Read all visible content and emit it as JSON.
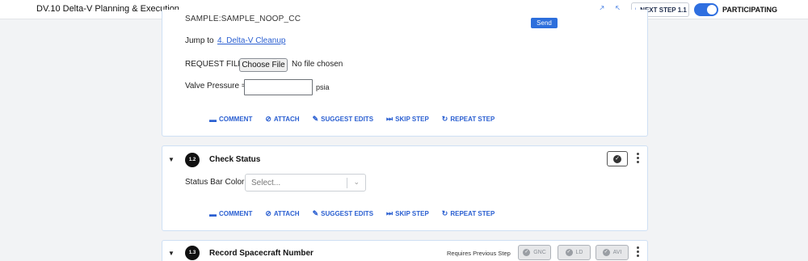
{
  "app": {
    "title": "DV.10 Delta-V Planning & Execution"
  },
  "topbar": {
    "expand_icon": "expand-icon",
    "collapse_icon": "collapse-icon",
    "next_step_label": "NEXT STEP 1.1",
    "participating_label": "PARTICIPATING",
    "participating": true
  },
  "step1": {
    "cut_text": "SAMPLE:SAMPLE_NOOP_CC",
    "send_label": "Send",
    "jump_label": "Jump to",
    "jump_link": "4. Delta-V Cleanup",
    "request_file_label": "REQUEST FILE",
    "choose_file_label": "Choose File",
    "no_file_text": "No file chosen",
    "valve_label": "Valve Pressure =",
    "valve_value": "",
    "valve_unit": "psia"
  },
  "actions": {
    "comment": "COMMENT",
    "attach": "ATTACH",
    "suggest_edits": "SUGGEST EDITS",
    "skip_step": "SKIP STEP",
    "repeat_step": "REPEAT STEP"
  },
  "step2": {
    "number": "1.2",
    "title": "Check Status",
    "field_label": "Status Bar Color",
    "select_placeholder": "Select..."
  },
  "step3": {
    "number": "1.3",
    "title": "Record Spacecraft Number",
    "requires_label": "Requires Previous Step",
    "roles": [
      "GNC",
      "LD",
      "AVI"
    ]
  },
  "colors": {
    "accent": "#2f6fe0",
    "link": "#2a5fd1",
    "card_border": "#cfe0f4"
  }
}
